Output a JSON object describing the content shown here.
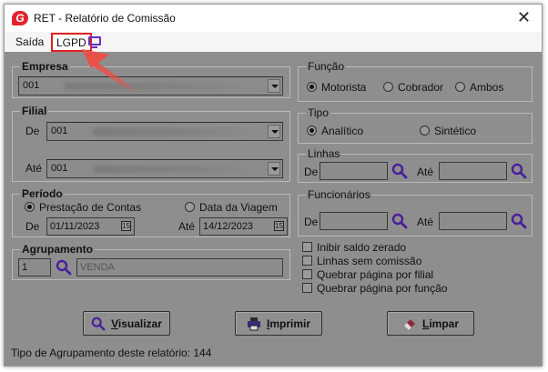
{
  "window": {
    "title": "RET - Relatório de Comissão",
    "app_icon_letter": "G",
    "close_glyph": "✕"
  },
  "menu": {
    "items": [
      "Saída",
      "LGPD"
    ],
    "highlight_color": "#e02020"
  },
  "empresa": {
    "title": "Empresa",
    "value": "001"
  },
  "filial": {
    "title": "Filial",
    "de_label": "De",
    "de_value": "001",
    "ate_label": "Até",
    "ate_value": "001"
  },
  "periodo": {
    "title": "Período",
    "options": [
      "Prestação de Contas",
      "Data da Viagem"
    ],
    "selected": "Prestação de Contas",
    "de_label": "De",
    "de_value": "01/11/2023",
    "ate_label": "Até",
    "ate_value": "14/12/2023",
    "calendar_glyph": "15"
  },
  "agrupamento": {
    "title": "Agrupamento",
    "code": "1",
    "description": "VENDA"
  },
  "funcao": {
    "title": "Função",
    "options": [
      "Motorista",
      "Cobrador",
      "Ambos"
    ],
    "selected": "Motorista"
  },
  "tipo": {
    "title": "Tipo",
    "options": [
      "Analítico",
      "Sintético"
    ],
    "selected": "Analítico"
  },
  "linhas": {
    "title": "Linhas",
    "de_label": "De",
    "ate_label": "Até",
    "de_value": "",
    "ate_value": ""
  },
  "funcionarios": {
    "title": "Funcionários",
    "de_label": "De",
    "ate_label": "Até",
    "de_value": "",
    "ate_value": ""
  },
  "checkboxes": [
    "Inibir saldo zerado",
    "Linhas sem comissão",
    "Quebrar página por filial",
    "Quebrar página por função"
  ],
  "buttons": {
    "visualizar": {
      "label_u": "V",
      "label_rest": "isualizar"
    },
    "imprimir": {
      "label_u": "I",
      "label_rest": "mprimir"
    },
    "limpar": {
      "label_u": "L",
      "label_rest": "impar"
    }
  },
  "status": "Tipo de Agrupamento deste relatório: 144",
  "colors": {
    "accent_icon": "#6a2ec4",
    "overlay": "#8e8e8e",
    "arrow": "#e8504a"
  }
}
